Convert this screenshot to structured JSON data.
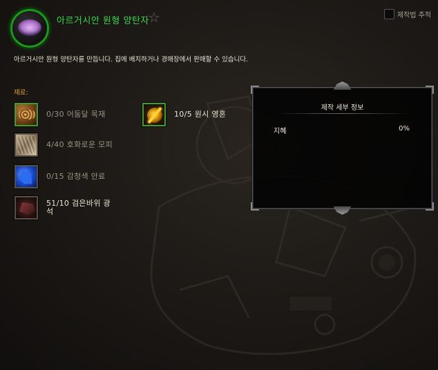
{
  "recipe": {
    "title": "아르거시안 원형 양탄자",
    "description": "아르거시안 원형 양탄자를 만듭니다. 집에 배치하거나 경매장에서 판매할 수 있습니다."
  },
  "track": {
    "label": "제작법 추적",
    "checked": false
  },
  "reagents_label": "재료:",
  "reagents": [
    {
      "text": "0/30 어둠달 목재",
      "icon": "wood-icon",
      "owned": false
    },
    {
      "text": "4/40 호화로운 모피",
      "icon": "hide-icon",
      "owned": false
    },
    {
      "text": "0/15 감청색 안료",
      "icon": "pigment-icon",
      "owned": false
    },
    {
      "text": "51/10 검은바위 광석",
      "icon": "ore-icon",
      "owned": true
    },
    {
      "text": "10/5 원시 영혼",
      "icon": "soul-icon",
      "owned": true
    }
  ],
  "details": {
    "title": "제작 세부 정보",
    "stat_name": "지혜",
    "stat_value": "0%"
  },
  "colors": {
    "title_green": "#38d84a",
    "reagent_label_gold": "#e0a020",
    "owned_border_green": "#3ca02a"
  }
}
